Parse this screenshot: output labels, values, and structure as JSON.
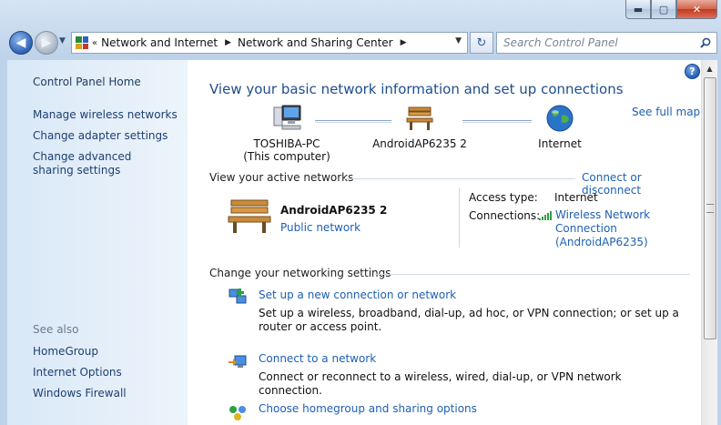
{
  "window": {
    "minimize": "▬",
    "maximize": "▢",
    "close": "✕"
  },
  "nav": {
    "back": "◀",
    "forward": "▶",
    "address_chevron": "«",
    "crumbs": [
      "Network and Internet",
      "Network and Sharing Center"
    ],
    "refresh": "↻",
    "search_placeholder": "Search Control Panel"
  },
  "sidebar": {
    "home": "Control Panel Home",
    "items": [
      "Manage wireless networks",
      "Change adapter settings",
      "Change advanced sharing settings"
    ],
    "see_also_heading": "See also",
    "see_also": [
      "HomeGroup",
      "Internet Options",
      "Windows Firewall"
    ]
  },
  "main": {
    "help": "?",
    "title": "View your basic network information and set up connections",
    "see_full_map": "See full map",
    "map": {
      "computer_name": "TOSHIBA-PC",
      "computer_sub": "(This computer)",
      "network": "AndroidAP6235  2",
      "internet": "Internet"
    },
    "active_networks_label": "View your active networks",
    "connect_or_disconnect": "Connect or disconnect",
    "active": {
      "name": "AndroidAP6235  2",
      "type": "Public network",
      "access_type_label": "Access type:",
      "access_type_value": "Internet",
      "connections_label": "Connections:",
      "connections_link": "Wireless Network Connection (AndroidAP6235)"
    },
    "change_settings_label": "Change your networking settings",
    "tasks": [
      {
        "title": "Set up a new connection or network",
        "desc": "Set up a wireless, broadband, dial-up, ad hoc, or VPN connection; or set up a router or access point."
      },
      {
        "title": "Connect to a network",
        "desc": "Connect or reconnect to a wireless, wired, dial-up, or VPN network connection."
      },
      {
        "title": "Choose homegroup and sharing options",
        "desc": ""
      }
    ]
  }
}
